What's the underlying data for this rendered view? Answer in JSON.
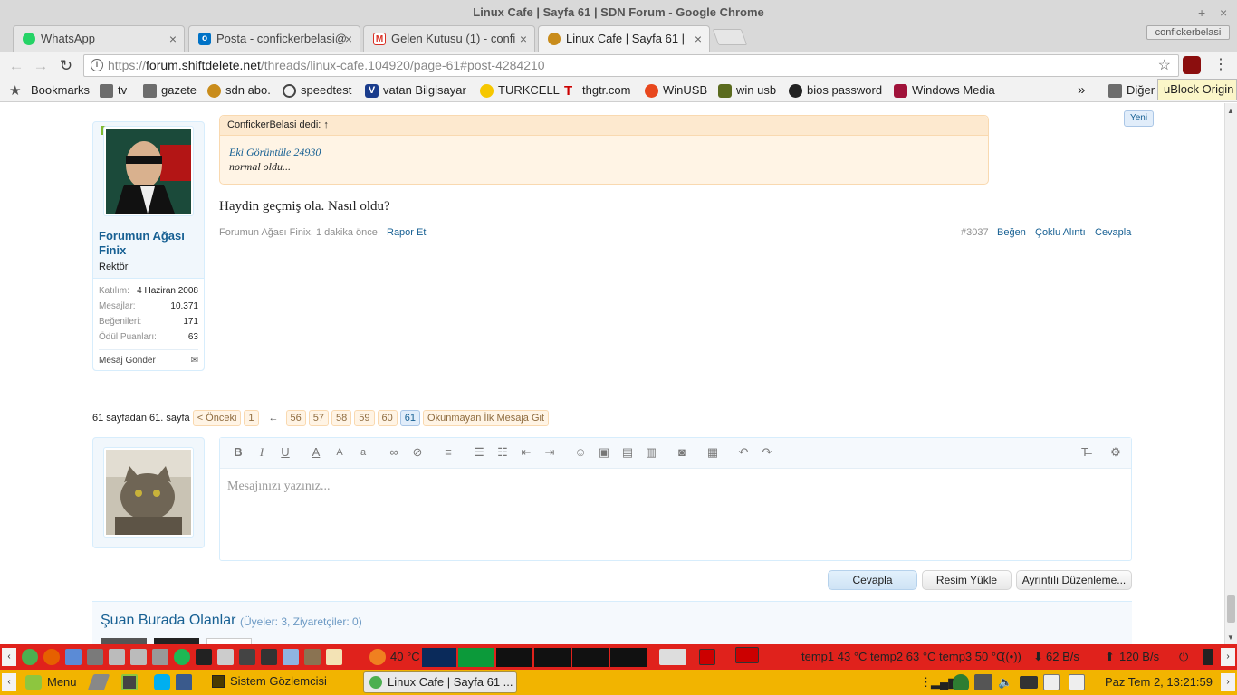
{
  "window": {
    "title": "Linux Cafe | Sayfa 61 | SDN Forum - Google Chrome",
    "controls": [
      "–",
      "+",
      "×"
    ]
  },
  "tabs": [
    {
      "label": "WhatsApp",
      "icon": "whatsapp-icon",
      "color": "#25d366"
    },
    {
      "label": "Posta - confickerbelasi@",
      "icon": "outlook-icon",
      "color": "#0072c6"
    },
    {
      "label": "Gelen Kutusu (1) - confi",
      "icon": "gmail-icon",
      "color": "#d93025"
    },
    {
      "label": "Linux Cafe | Sayfa 61 |",
      "icon": "shiftdelete-icon",
      "color": "#c98c1b"
    }
  ],
  "profile_name": "confickerbelasi",
  "toolbar": {
    "url_prefix": "https://",
    "url_host": "forum.shiftdelete.net",
    "url_path": "/threads/linux-cafe.104920/page-61#post-4284210"
  },
  "bookmarks": {
    "label": "Bookmarks",
    "items": [
      "tv",
      "gazete",
      "sdn abo.",
      "speedtest",
      "vatan Bilgisayar",
      "TURKCELL",
      "thgtr.com",
      "WinUSB",
      "win usb",
      "bios password",
      "Windows Media"
    ],
    "overflow": "»",
    "other": "Diğer"
  },
  "extension_tooltip": "uBlock Origin",
  "post": {
    "new_badge": "Yeni",
    "quote_header": "ConfickerBelasi dedi: ↑",
    "quote_link": "Eki Görüntüle 24930",
    "quote_text": "normal oldu...",
    "message": "Haydin geçmiş ola. Nasıl oldu?",
    "author_meta": "Forumun Ağası Finix, 1 dakika önce",
    "report": "Rapor Et",
    "post_number": "#3037",
    "like": "Beğen",
    "multi_quote": "Çoklu Alıntı",
    "reply": "Cevapla"
  },
  "user": {
    "name": "Forumun Ağası Finix",
    "title": "Rektör",
    "stats": [
      {
        "label": "Katılım:",
        "value": "4 Haziran 2008"
      },
      {
        "label": "Mesajlar:",
        "value": "10.371"
      },
      {
        "label": "Beğenileri:",
        "value": "171"
      },
      {
        "label": "Ödül Puanları:",
        "value": "63"
      }
    ],
    "send_message": "Mesaj Gönder"
  },
  "pagination": {
    "summary": "61 sayfadan 61. sayfa",
    "prev": "< Önceki",
    "first": "1",
    "gap": "←",
    "pages": [
      "56",
      "57",
      "58",
      "59",
      "60",
      "61"
    ],
    "current": "61",
    "unread": "Okunmayan İlk Mesaja Git"
  },
  "editor": {
    "placeholder": "Mesajınızı yazınız...",
    "buttons": [
      "B",
      "I",
      "U",
      "A",
      "A",
      "a"
    ]
  },
  "actions": {
    "reply": "Cevapla",
    "upload": "Resim Yükle",
    "advanced": "Ayrıntılı Düzenleme..."
  },
  "online": {
    "title": "Şuan Burada Olanlar",
    "counts": "(Üyeler: 3, Ziyaretçiler: 0)"
  },
  "panel_top": {
    "cpu_temp": "40 °C",
    "sensors": "temp1 43 °C temp2 63 °C temp3 50 °C",
    "download": "62 B/s",
    "upload": "120 B/s"
  },
  "panel_bottom": {
    "menu": "Menu",
    "tasks": [
      "Sistem Gözlemcisi",
      "Linux Cafe | Sayfa 61 ..."
    ],
    "clock": "Paz Tem  2, 13:21:59"
  }
}
